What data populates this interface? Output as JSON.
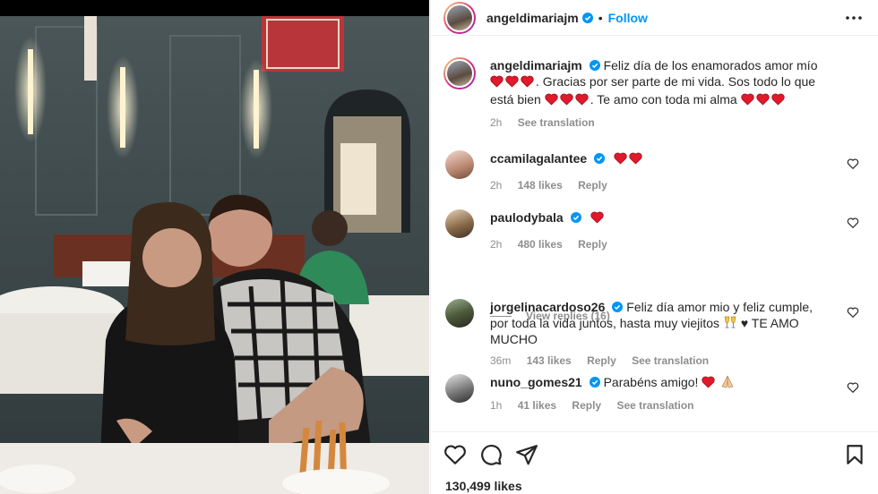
{
  "post": {
    "author": "angeldimariajm",
    "follow_label": "Follow",
    "separator": "•",
    "likes": "130,499 likes",
    "caption": {
      "username": "angeldimariajm",
      "text_1": "Feliz día de los enamorados amor mío",
      "text_2": ". Gracias por ser parte de mi vida. Sos todo lo que está bien",
      "text_3": ". Te amo con toda mi alma",
      "time": "2h",
      "translate": "See translation"
    }
  },
  "comments": [
    {
      "username": "ccamilagalantee",
      "text": "",
      "time": "2h",
      "likes": "148 likes",
      "reply": "Reply",
      "translate": ""
    },
    {
      "username": "paulodybala",
      "text": "",
      "time": "2h",
      "likes": "480 likes",
      "reply": "Reply",
      "translate": ""
    },
    {
      "username": "jorgelinacardoso26",
      "text": "Feliz día amor mio y feliz cumple, por toda la vida juntos, hasta muy viejitos",
      "text_tail": "♥ TE AMO MUCHO",
      "time": "36m",
      "likes": "143 likes",
      "reply": "Reply",
      "translate": "See translation"
    },
    {
      "username": "nuno_gomes21",
      "text": "Parabéns amigo!",
      "time": "1h",
      "likes": "41 likes",
      "reply": "Reply",
      "translate": "See translation"
    }
  ],
  "view_replies": "View replies (16)",
  "icons": {
    "verified": "verified-badge-icon",
    "more": "more-options-icon",
    "heart": "heart-icon",
    "comment": "comment-icon",
    "share": "share-icon",
    "bookmark": "bookmark-icon"
  },
  "colors": {
    "accent": "#0095f6",
    "verified": "#0095f6",
    "emoji_heart": "#e0192b",
    "muted": "#8e8e8e"
  }
}
